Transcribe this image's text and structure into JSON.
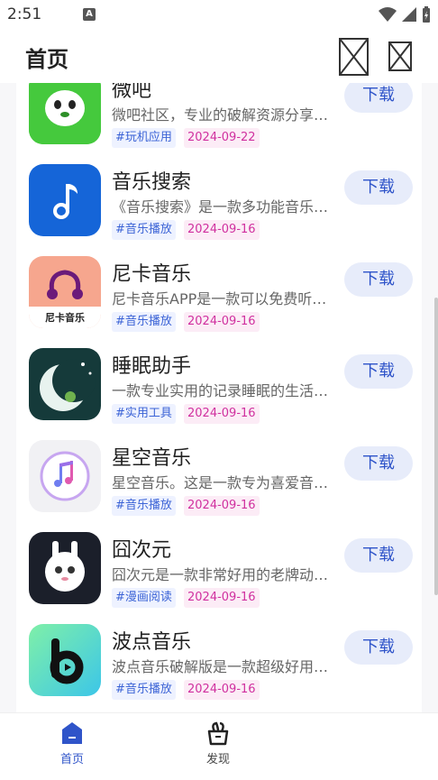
{
  "status_bar": {
    "time": "2:51",
    "notification_icon": "A"
  },
  "header": {
    "title": "首页"
  },
  "apps": [
    {
      "name": "微吧",
      "desc": "微吧社区，专业的破解资源分享社区",
      "category": "#玩机应用",
      "date": "2024-09-22",
      "download": "下载",
      "icon": "ghost-icon"
    },
    {
      "name": "音乐搜索",
      "desc": "《音乐搜索》是一款多功能音乐播放软件",
      "category": "#音乐播放",
      "date": "2024-09-16",
      "download": "下载",
      "icon": "music-note-icon"
    },
    {
      "name": "尼卡音乐",
      "desc": "尼卡音乐APP是一款可以免费听歌的软件",
      "category": "#音乐播放",
      "date": "2024-09-16",
      "download": "下载",
      "icon_label": "尼卡音乐",
      "icon": "headphones-icon"
    },
    {
      "name": "睡眠助手",
      "desc": "一款专业实用的记录睡眠的生活工具",
      "category": "#实用工具",
      "date": "2024-09-16",
      "download": "下载",
      "icon": "moon-icon"
    },
    {
      "name": "星空音乐",
      "desc": "星空音乐。这是一款专为喜爱音乐的人打造",
      "category": "#音乐播放",
      "date": "2024-09-16",
      "download": "下载",
      "icon": "itunes-note-icon"
    },
    {
      "name": "囧次元",
      "desc": "囧次元是一款非常好用的老牌动漫软件",
      "category": "#漫画阅读",
      "date": "2024-09-16",
      "download": "下载",
      "icon": "bunny-icon"
    },
    {
      "name": "波点音乐",
      "desc": "波点音乐破解版是一款超级好用的听歌软件",
      "category": "#音乐播放",
      "date": "2024-09-16",
      "download": "下载",
      "icon": "b-letter-icon"
    }
  ],
  "bottom_nav": [
    {
      "label": "首页",
      "active": true
    },
    {
      "label": "发现",
      "active": false
    }
  ],
  "colors": {
    "accent": "#2f54c9",
    "tag_cat": "#3b63d6",
    "tag_date": "#d0309f"
  }
}
